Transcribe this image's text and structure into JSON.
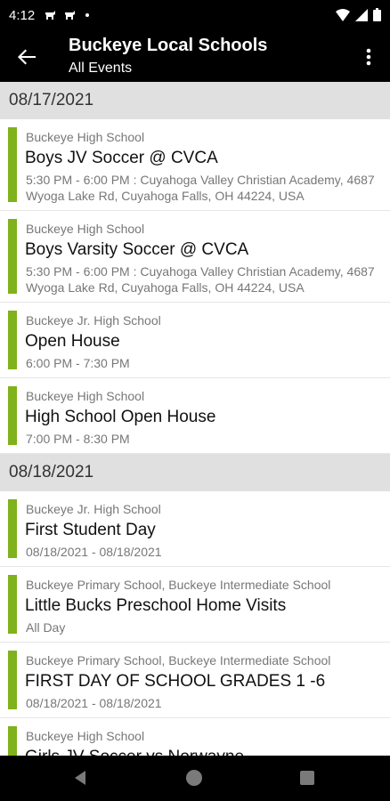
{
  "status_bar": {
    "time": "4:12"
  },
  "app_bar": {
    "title": "Buckeye Local Schools",
    "subtitle": "All Events"
  },
  "groups": [
    {
      "date": "08/17/2021",
      "events": [
        {
          "school": "Buckeye High School",
          "name": "Boys JV Soccer @ CVCA",
          "details": "5:30 PM - 6:00 PM : Cuyahoga Valley Christian Academy, 4687 Wyoga Lake Rd, Cuyahoga Falls, OH 44224, USA"
        },
        {
          "school": "Buckeye High School",
          "name": "Boys Varsity Soccer @ CVCA",
          "details": "5:30 PM - 6:00 PM : Cuyahoga Valley Christian Academy, 4687 Wyoga Lake Rd, Cuyahoga Falls, OH 44224, USA"
        },
        {
          "school": "Buckeye Jr. High School",
          "name": "Open House",
          "details": "6:00 PM - 7:30 PM"
        },
        {
          "school": "Buckeye High School",
          "name": "High School Open House",
          "details": "7:00 PM - 8:30 PM"
        }
      ]
    },
    {
      "date": "08/18/2021",
      "events": [
        {
          "school": "Buckeye Jr. High School",
          "name": "First Student Day",
          "details": "08/18/2021 - 08/18/2021"
        },
        {
          "school": "Buckeye Primary School, Buckeye Intermediate School",
          "name": "Little Bucks Preschool Home Visits",
          "details": "All Day"
        },
        {
          "school": "Buckeye Primary School, Buckeye Intermediate School",
          "name": "FIRST DAY OF SCHOOL GRADES 1 -6",
          "details": "08/18/2021 - 08/18/2021"
        },
        {
          "school": "Buckeye High School",
          "name": "Girls JV Soccer vs Norwayne",
          "details": ""
        }
      ]
    }
  ],
  "colors": {
    "accent": "#7fb21b",
    "header_bg": "#e0e0e0",
    "bar_bg": "#000000"
  }
}
